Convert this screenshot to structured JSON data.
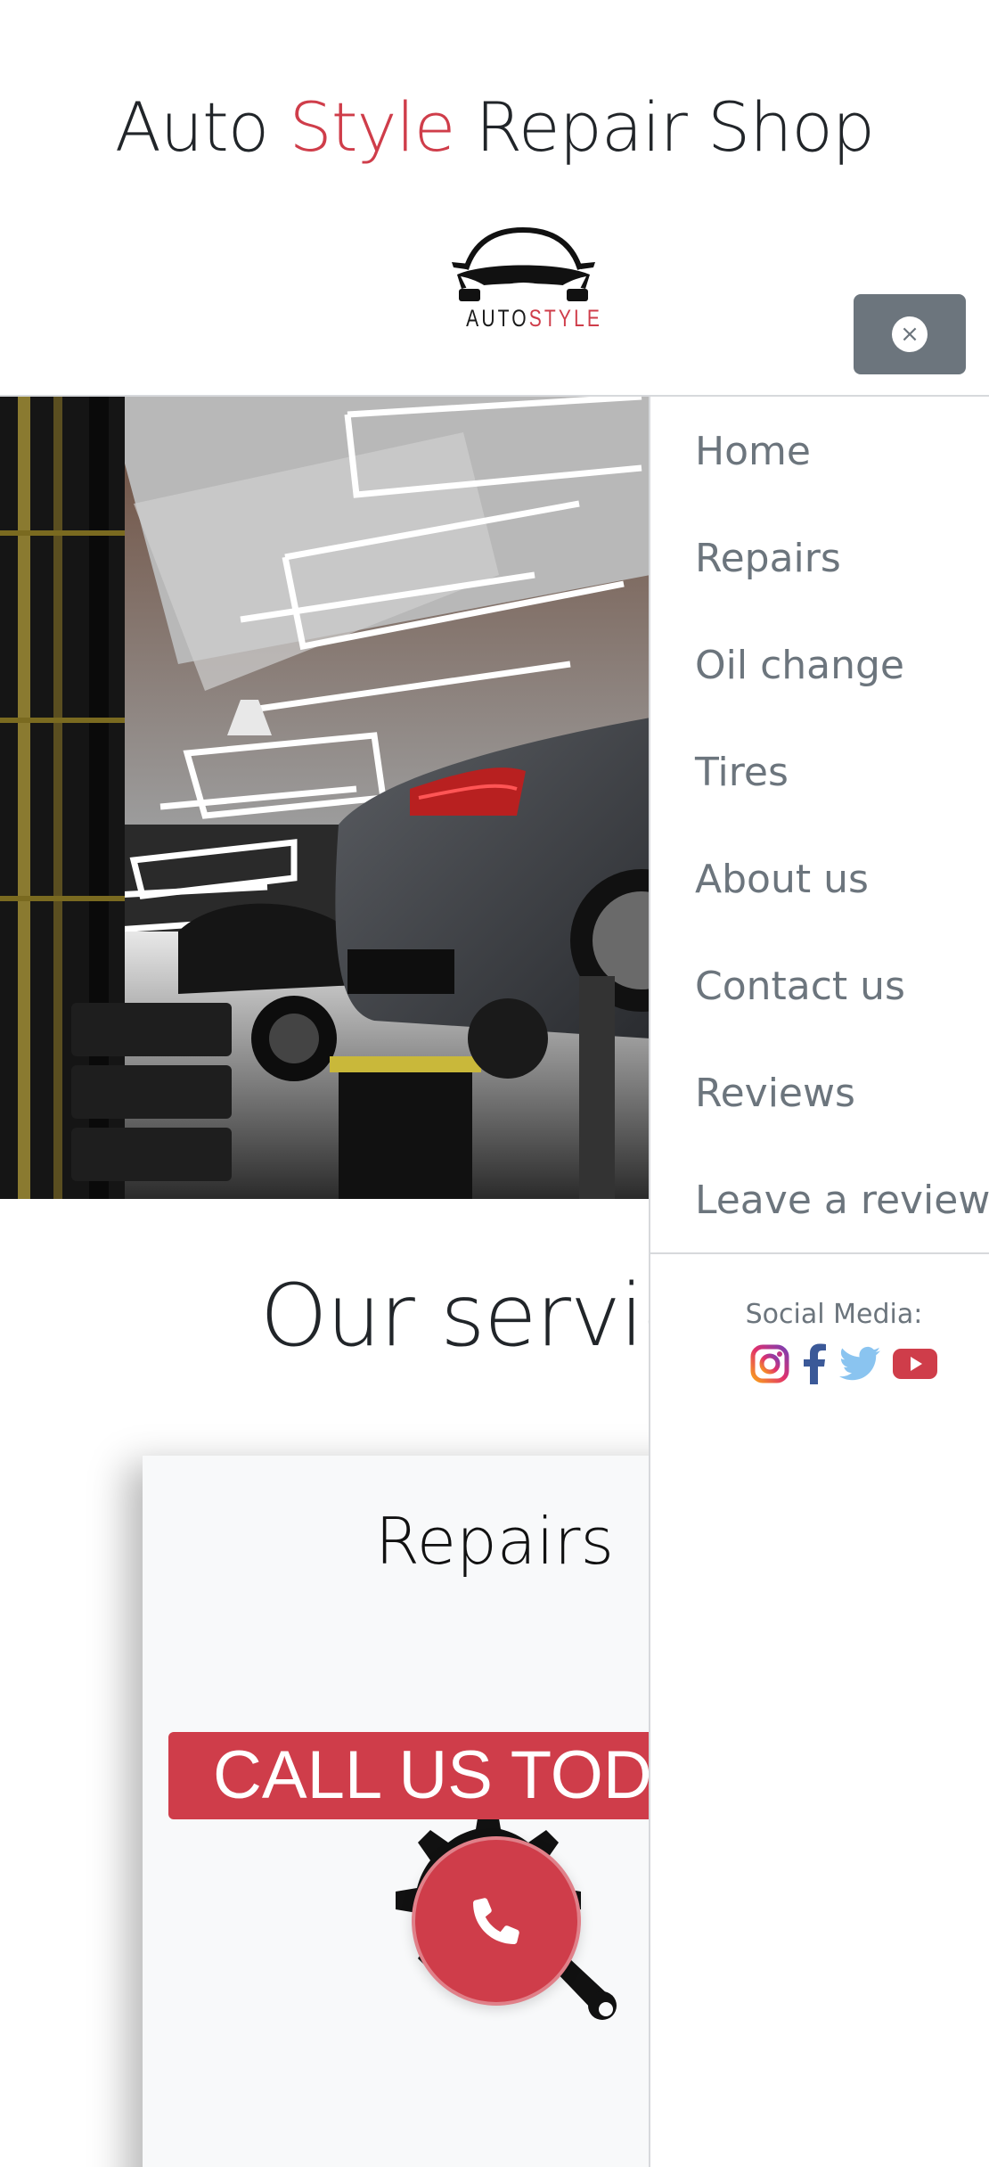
{
  "header": {
    "title_part1": "Auto",
    "title_accent": "Style",
    "title_part2": "Repair Shop",
    "logo_text_1": "AUTO",
    "logo_text_2": "STYLE",
    "close_symbol": "×"
  },
  "colors": {
    "accent": "#cf3d4a",
    "menu_text": "#6c757d",
    "close_button": "#6c757d"
  },
  "hero": {
    "image": "garage-cars-on-lifts-photo"
  },
  "services": {
    "section_title": "Our servic",
    "card_title": "Repairs",
    "card_icon": "gear-wrench-icon"
  },
  "cta": {
    "banner_text": "CALL US TOD",
    "fab_icon": "phone-icon"
  },
  "menu": {
    "items": [
      {
        "label": "Home"
      },
      {
        "label": "Repairs"
      },
      {
        "label": "Oil change"
      },
      {
        "label": "Tires"
      },
      {
        "label": "About us"
      },
      {
        "label": "Contact us"
      },
      {
        "label": "Reviews"
      },
      {
        "label": "Leave a review"
      }
    ],
    "social_label": "Social Media:",
    "social_icons": [
      "instagram-icon",
      "facebook-icon",
      "twitter-icon",
      "youtube-icon"
    ]
  }
}
